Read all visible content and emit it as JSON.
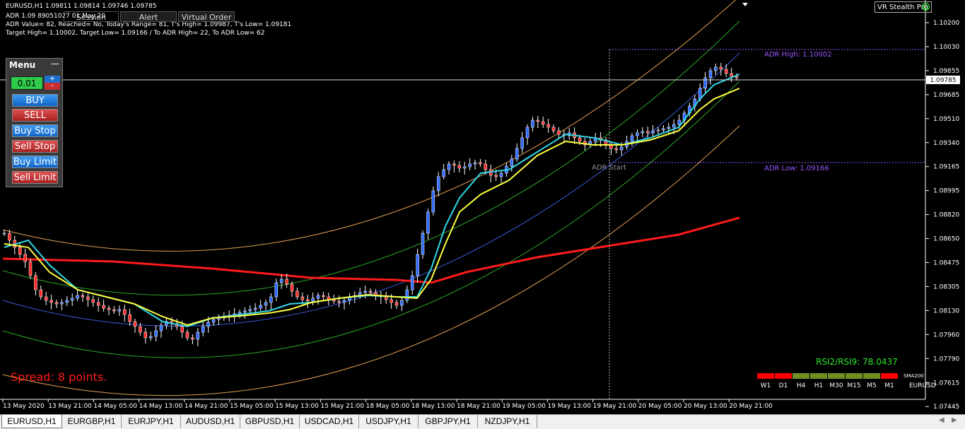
{
  "header": {
    "symbol_line": "EURUSD,H1  1.09811 1.09814 1.09746 1.09785",
    "adr_line1": "ADR 1.09 89051027 01 May 20",
    "adr_line2": "ADR Value= 82, Reached= No, Today's Range= 81, T's High= 1.09987, T's Low= 1.09181",
    "adr_line3": "Target High= 1.10002, Target Low= 1.09166 / To ADR High= 22, To ADR Low= 62"
  },
  "top_tabs": [
    "Session",
    "Alert",
    "Virtual Order"
  ],
  "vr_label": "VR Stealth Pro",
  "menu": {
    "title": "Menu",
    "minimize": "—",
    "lot": "0.01",
    "plus": "+",
    "minus": "-",
    "buttons": [
      "BUY",
      "SELL",
      "Buy Stop",
      "Sell Stop",
      "Buy Limit",
      "Sell Limit"
    ]
  },
  "spread": "Spread: 8 points.",
  "rsi": "RSI2/RSI9: 78.0437",
  "matrix": {
    "labels": [
      "W1",
      "D1",
      "H4",
      "H1",
      "M30",
      "M15",
      "M5",
      "M1"
    ],
    "states": [
      "down",
      "down",
      "up",
      "up",
      "up",
      "up",
      "up",
      "down"
    ],
    "sma_label": "SMA200",
    "symbol": "EURUSD"
  },
  "price_axis": [
    "1.10200",
    "1.10030",
    "1.09855",
    "1.09685",
    "1.09510",
    "1.09340",
    "1.09165",
    "1.08995",
    "1.08820",
    "1.08650",
    "1.08475",
    "1.08305",
    "1.08130",
    "1.07960",
    "1.07790",
    "1.07615",
    "1.07445"
  ],
  "current_price": "1.09785",
  "time_axis": [
    "13 May 2020",
    "13 May 21:00",
    "14 May 05:00",
    "14 May 13:00",
    "14 May 21:00",
    "15 May 05:00",
    "15 May 13:00",
    "15 May 21:00",
    "18 May 05:00",
    "18 May 13:00",
    "18 May 21:00",
    "19 May 05:00",
    "19 May 13:00",
    "19 May 21:00",
    "20 May 05:00",
    "20 May 13:00",
    "20 May 21:00"
  ],
  "levels": {
    "adr_high": "ADR High: 1.10002",
    "adr_low": "ADR Low: 1.09166",
    "adr_start": "ADR Start"
  },
  "symbol_tabs": [
    "EURUSD,H1",
    "EURGBP,H1",
    "EURJPY,H1",
    "AUDUSD,H1",
    "GBPUSD,H1",
    "USDCAD,H1",
    "USDJPY,H1",
    "GBPJPY,H1",
    "NZDJPY,H1"
  ],
  "colors": {
    "bull": "#2f6bff",
    "bear": "#ff2b2b",
    "ma_fast": "#30d8e8",
    "ma_slow": "#ffff40",
    "sma200": "#ff1a1a",
    "adr": "#9955ff",
    "up_cell": "#6f8f20",
    "down_cell": "#ff0000"
  }
}
